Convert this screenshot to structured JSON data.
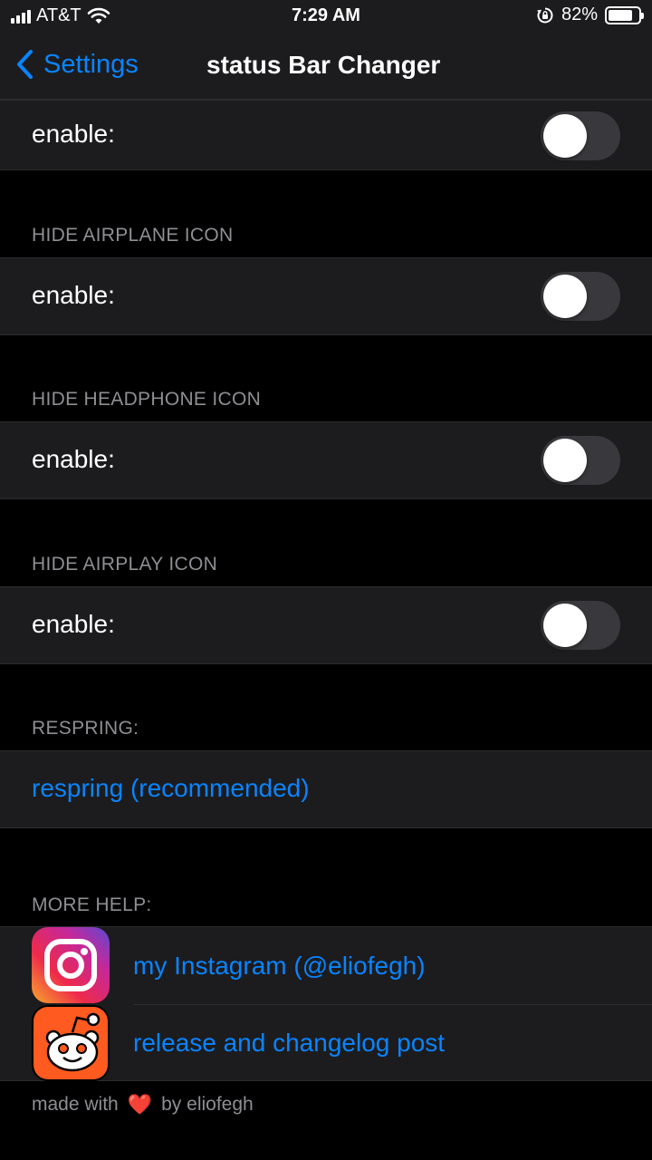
{
  "status_bar": {
    "carrier": "AT&T",
    "time": "7:29 AM",
    "battery": "82%",
    "battery_fraction": 0.82
  },
  "nav": {
    "back_label": "Settings",
    "title": "status Bar Changer"
  },
  "sections": [
    {
      "header": "",
      "row_label": "enable:",
      "toggle_on": false
    },
    {
      "header": "HIDE AIRPLANE ICON",
      "row_label": "enable:",
      "toggle_on": false
    },
    {
      "header": "HIDE HEADPHONE ICON",
      "row_label": "enable:",
      "toggle_on": false
    },
    {
      "header": "HIDE AIRPLAY ICON",
      "row_label": "enable:",
      "toggle_on": false
    }
  ],
  "respring": {
    "header": "RESPRING:",
    "button_label": "respring (recommended)"
  },
  "help": {
    "header": "MORE HELP:",
    "links": [
      {
        "label": "my Instagram (@eliofegh)",
        "icon": "instagram-icon"
      },
      {
        "label": "release and changelog post",
        "icon": "reddit-icon"
      }
    ]
  },
  "footer": {
    "prefix": "made with",
    "suffix": "by eliofegh",
    "heart": "❤️"
  },
  "colors": {
    "accent": "#0a84ff",
    "cell_bg": "#1c1c1e",
    "toggle_off": "#39393d",
    "secondary_text": "#8e8e93"
  }
}
